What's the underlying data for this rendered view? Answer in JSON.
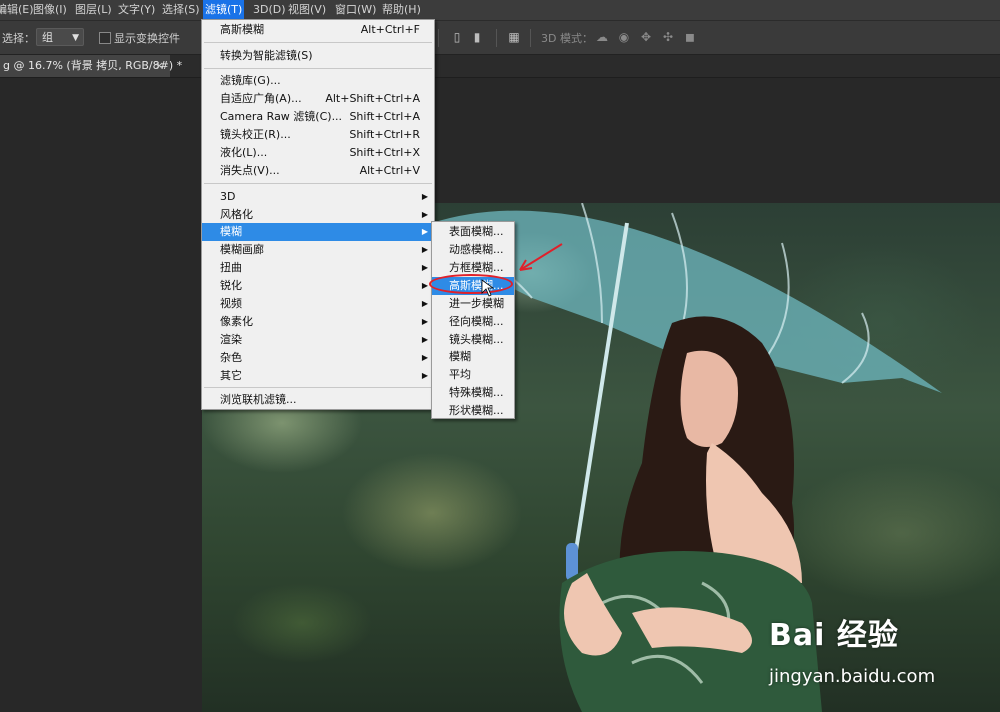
{
  "menubar": {
    "items": [
      {
        "label": "编辑(E)"
      },
      {
        "label": "图像(I)"
      },
      {
        "label": "图层(L)"
      },
      {
        "label": "文字(Y)"
      },
      {
        "label": "选择(S)"
      },
      {
        "label": "滤镜(T)",
        "active": true
      },
      {
        "label": "3D(D)"
      },
      {
        "label": "视图(V)"
      },
      {
        "label": "窗口(W)"
      },
      {
        "label": "帮助(H)"
      }
    ]
  },
  "options": {
    "select_label": "选择：",
    "select_value": "组",
    "show_transform_label": "显示变换控件",
    "mode_3d_label": "3D 模式："
  },
  "document_tab": {
    "title": "g @ 16.7% (背景 拷贝, RGB/8#) *",
    "close": "×"
  },
  "filter_menu": {
    "items": [
      {
        "label": "高斯模糊",
        "shortcut": "Alt+Ctrl+F"
      },
      {
        "label": "转换为智能滤镜(S)",
        "shortcut": ""
      },
      {
        "label": "滤镜库(G)...",
        "shortcut": ""
      },
      {
        "label": "自适应广角(A)...",
        "shortcut": "Alt+Shift+Ctrl+A"
      },
      {
        "label": "Camera Raw 滤镜(C)...",
        "shortcut": "Shift+Ctrl+A"
      },
      {
        "label": "镜头校正(R)...",
        "shortcut": "Shift+Ctrl+R"
      },
      {
        "label": "液化(L)...",
        "shortcut": "Shift+Ctrl+X"
      },
      {
        "label": "消失点(V)...",
        "shortcut": "Alt+Ctrl+V"
      },
      {
        "label": "3D",
        "submenu": true
      },
      {
        "label": "风格化",
        "submenu": true
      },
      {
        "label": "模糊",
        "submenu": true,
        "highlighted": true
      },
      {
        "label": "模糊画廊",
        "submenu": true
      },
      {
        "label": "扭曲",
        "submenu": true
      },
      {
        "label": "锐化",
        "submenu": true
      },
      {
        "label": "视频",
        "submenu": true
      },
      {
        "label": "像素化",
        "submenu": true
      },
      {
        "label": "渲染",
        "submenu": true
      },
      {
        "label": "杂色",
        "submenu": true
      },
      {
        "label": "其它",
        "submenu": true
      },
      {
        "label": "浏览联机滤镜...",
        "shortcut": ""
      }
    ]
  },
  "blur_submenu": {
    "items": [
      {
        "label": "表面模糊..."
      },
      {
        "label": "动感模糊..."
      },
      {
        "label": "方框模糊..."
      },
      {
        "label": "高斯模糊...",
        "highlighted": true
      },
      {
        "label": "进一步模糊"
      },
      {
        "label": "径向模糊..."
      },
      {
        "label": "镜头模糊..."
      },
      {
        "label": "模糊"
      },
      {
        "label": "平均"
      },
      {
        "label": "特殊模糊..."
      },
      {
        "label": "形状模糊..."
      }
    ]
  },
  "watermark": {
    "logo_text": "Bai 经验",
    "url": "jingyan.baidu.com"
  },
  "colors": {
    "highlight": "#2e8be6",
    "annotation": "#e0202a"
  }
}
